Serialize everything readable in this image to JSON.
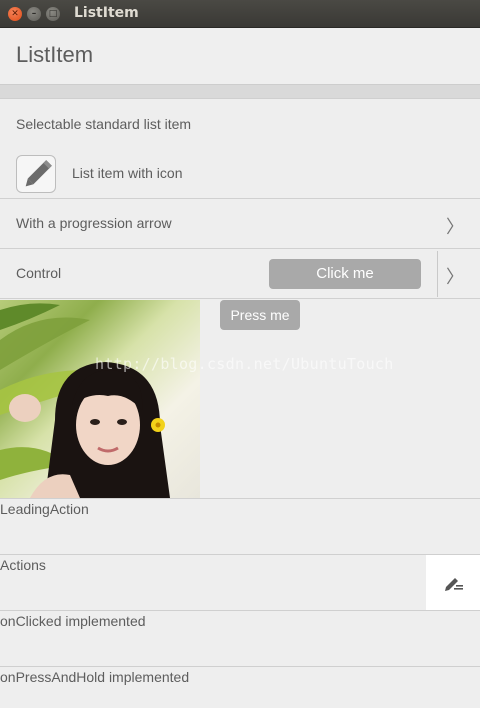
{
  "window": {
    "title": "ListItem",
    "controls": [
      "close",
      "minimize",
      "maximize"
    ]
  },
  "header": {
    "title": "ListItem"
  },
  "rows": {
    "selectable": "Selectable standard list item",
    "with_icon": "List item with icon",
    "progression": "With a progression arrow",
    "control": "Control",
    "click_button": "Click me",
    "press_button": "Press me"
  },
  "watermark": "http://blog.csdn.net/UbuntuTouch",
  "action_rows": {
    "leading": "LeadingAction",
    "actions": "Actions",
    "on_clicked": "onClicked implemented",
    "on_press_hold": "onPressAndHold implemented"
  },
  "icons": {
    "list_item_icon": "pencil-icon",
    "trailing_action": "edit-icon",
    "progression": "chevron-right-icon"
  },
  "colors": {
    "titlebar": "#3c3b37",
    "close_button": "#df4b16",
    "background": "#eeeeee",
    "button": "#a9a9a9"
  }
}
